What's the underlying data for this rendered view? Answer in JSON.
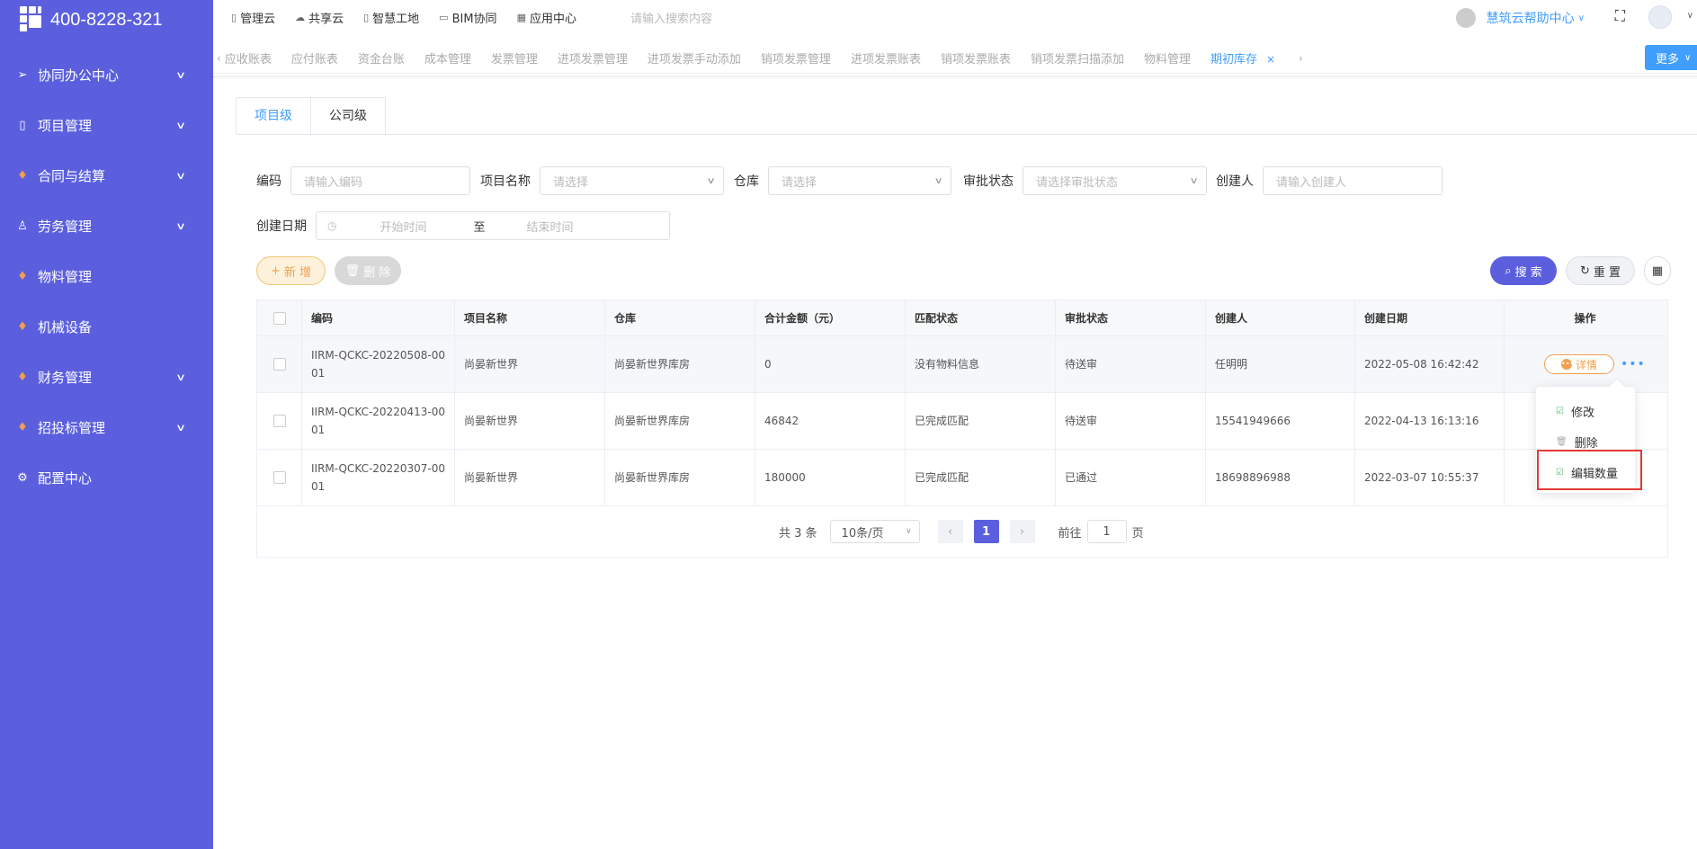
{
  "logo": {
    "phone": "400-8228-321"
  },
  "sidebar": {
    "items": [
      {
        "label": "协同办公中心",
        "icon": "send-icon",
        "has_children": true
      },
      {
        "label": "项目管理",
        "icon": "book-icon",
        "has_children": true
      },
      {
        "label": "合同与结算",
        "icon": "gem-icon",
        "has_children": true
      },
      {
        "label": "劳务管理",
        "icon": "user-icon",
        "has_children": true
      },
      {
        "label": "物料管理",
        "icon": "gem-icon",
        "has_children": false
      },
      {
        "label": "机械设备",
        "icon": "gem-icon",
        "has_children": false
      },
      {
        "label": "财务管理",
        "icon": "gem-icon",
        "has_children": true
      },
      {
        "label": "招投标管理",
        "icon": "gem-icon",
        "has_children": true
      },
      {
        "label": "配置中心",
        "icon": "gear-icon",
        "has_children": false
      }
    ]
  },
  "topbar": {
    "links": [
      "管理云",
      "共享云",
      "智慧工地",
      "BIM协同",
      "应用中心"
    ],
    "search_placeholder": "请输入搜索内容",
    "help_label": "慧筑云帮助中心"
  },
  "tabs": {
    "items": [
      "应收账表",
      "应付账表",
      "资金台账",
      "成本管理",
      "发票管理",
      "进项发票管理",
      "进项发票手动添加",
      "销项发票管理",
      "进项发票账表",
      "销项发票账表",
      "销项发票扫描添加",
      "物料管理"
    ],
    "active": "期初库存",
    "more_label": "更多"
  },
  "level_tabs": {
    "project": "项目级",
    "company": "公司级"
  },
  "filters": {
    "code_label": "编码",
    "code_placeholder": "请输入编码",
    "project_label": "项目名称",
    "project_placeholder": "请选择",
    "warehouse_label": "仓库",
    "warehouse_placeholder": "请选择",
    "approval_label": "审批状态",
    "approval_placeholder": "请选择审批状态",
    "creator_label": "创建人",
    "creator_placeholder": "请输入创建人",
    "date_label": "创建日期",
    "date_start": "开始时间",
    "date_sep": "至",
    "date_end": "结束时间"
  },
  "actions": {
    "add": "新 增",
    "delete": "删 除",
    "search": "搜 索",
    "reset": "重 置"
  },
  "table": {
    "columns": [
      "编码",
      "项目名称",
      "仓库",
      "合计金额（元）",
      "匹配状态",
      "审批状态",
      "创建人",
      "创建日期",
      "操作"
    ],
    "rows": [
      {
        "code_line1": "IIRM-QCKC-20220508-00",
        "code_line2": "01",
        "project": "尚晏新世界",
        "warehouse": "尚晏新世界库房",
        "amount": "0",
        "match": "没有物料信息",
        "approval": "待送审",
        "creator": "任明明",
        "date": "2022-05-08 16:42:42"
      },
      {
        "code_line1": "IIRM-QCKC-20220413-00",
        "code_line2": "01",
        "project": "尚晏新世界",
        "warehouse": "尚晏新世界库房",
        "amount": "46842",
        "match": "已完成匹配",
        "approval": "待送审",
        "creator": "15541949666",
        "date": "2022-04-13 16:13:16"
      },
      {
        "code_line1": "IIRM-QCKC-20220307-00",
        "code_line2": "01",
        "project": "尚晏新世界",
        "warehouse": "尚晏新世界库房",
        "amount": "180000",
        "match": "已完成匹配",
        "approval": "已通过",
        "creator": "18698896988",
        "date": "2022-03-07 10:55:37"
      }
    ],
    "detail_label": "详情"
  },
  "dropdown": {
    "edit": "修改",
    "delete": "删除",
    "edit_qty": "编辑数量"
  },
  "pagination": {
    "total": "共 3 条",
    "page_size": "10条/页",
    "current": "1",
    "goto_label": "前往",
    "goto_value": "1",
    "page_suffix": "页"
  }
}
